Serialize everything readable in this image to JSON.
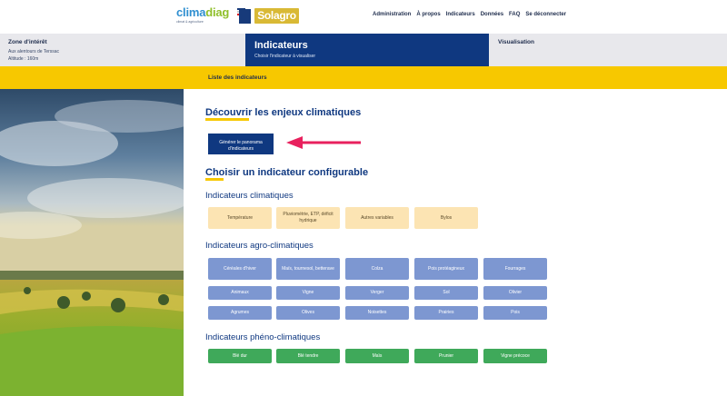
{
  "header": {
    "logo_climadiag_part1": "clima",
    "logo_climadiag_part2": "diag",
    "logo_climadiag_tagline": "climat & agriculture",
    "logo_solagro": "Solagro",
    "nav": [
      "Administration",
      "À propos",
      "Indicateurs",
      "Données",
      "FAQ",
      "Se déconnecter"
    ]
  },
  "steps": {
    "zone_title": "Zone d'intérêt",
    "zone_lines": [
      "Aux alentours de Terssac",
      "Altitude : 160m"
    ],
    "active_title": "Indicateurs",
    "active_subtitle": "Choisir l'indicateur à visualiser",
    "right_title": "Visualisation"
  },
  "subnav": {
    "title": "Liste des indicateurs"
  },
  "section1": {
    "title": "Découvrir les enjeux climatiques",
    "button_label": "Générer le panorama d'indicateurs"
  },
  "section2": {
    "title": "Choisir un indicateur configurable"
  },
  "climatiques": {
    "title": "Indicateurs climatiques",
    "tiles": [
      "Température",
      "Pluviométrie, ETP, déficit hydrique",
      "Autres variables",
      "Bylos"
    ]
  },
  "agro": {
    "title": "Indicateurs agro-climatiques",
    "row1": [
      "Céréales d'hiver",
      "Maïs, tournesol, betterave",
      "Colza",
      "Pois protéagineux",
      "Fourrages"
    ],
    "row2": [
      "Animaux",
      "Vigne",
      "Verger",
      "Sol",
      "Olivier"
    ],
    "row3": [
      "Agrumes",
      "Olives",
      "Noisettes",
      "Prairies",
      "Pois"
    ]
  },
  "pheno": {
    "title": "Indicateurs phéno-climatiques",
    "tiles": [
      "Blé dur",
      "Blé tendre",
      "Maïs",
      "Prunier",
      "Vigne précoce"
    ]
  },
  "colors": {
    "navy": "#0f3880",
    "yellow": "#f7c800",
    "climatique_tile": "#fce4b3",
    "agro_tile": "#7d97d1",
    "pheno_tile": "#3fa95a",
    "arrow": "#e8215e"
  }
}
